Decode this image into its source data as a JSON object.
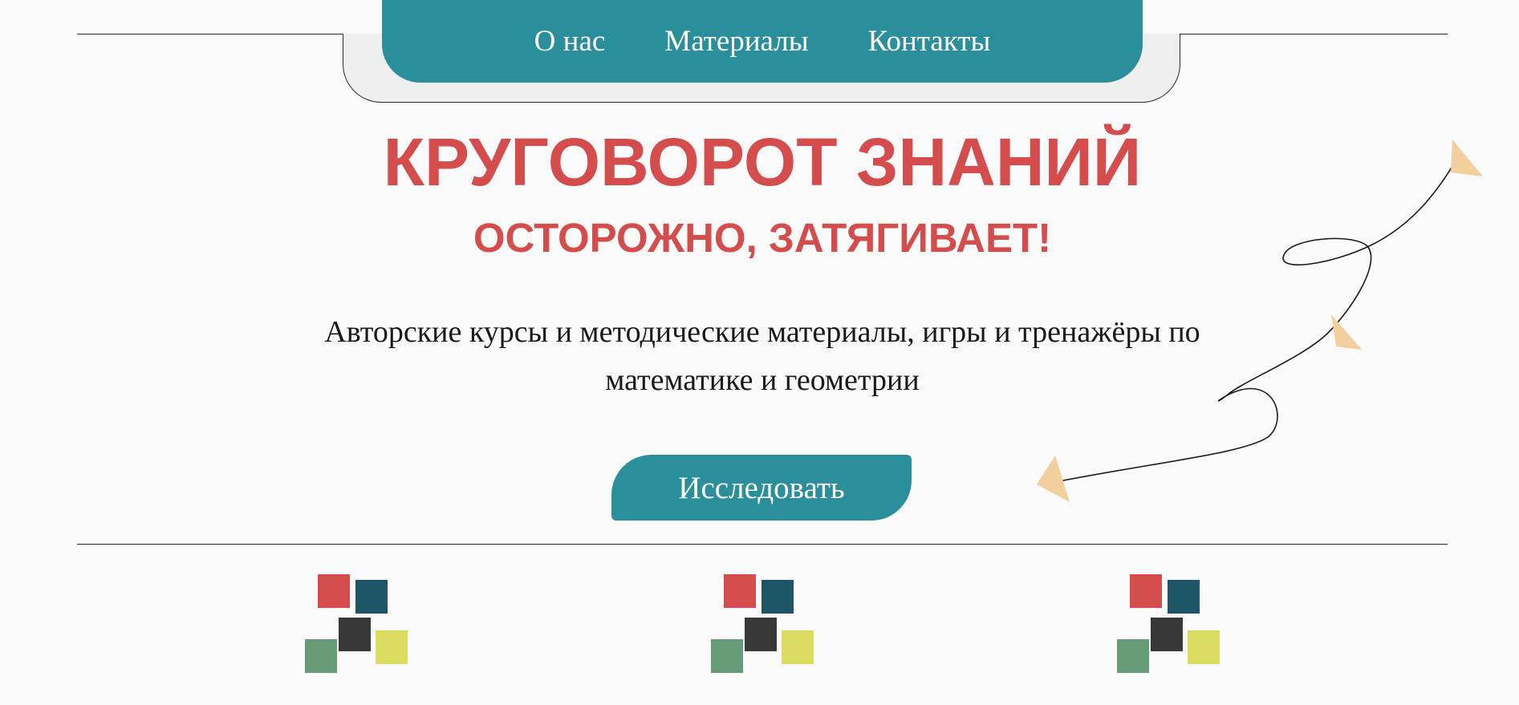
{
  "nav": {
    "items": [
      {
        "label": "О нас"
      },
      {
        "label": "Материалы"
      },
      {
        "label": "Контакты"
      }
    ]
  },
  "hero": {
    "title": "КРУГОВОРОТ ЗНАНИЙ",
    "subtitle": "ОСТОРОЖНО, ЗАТЯГИВАЕТ!",
    "description": "Авторские курсы и методические материалы, игры и тренажёры по математике и геометрии",
    "cta_label": "Исследовать"
  },
  "colors": {
    "accent_teal": "#2a8f9a",
    "title_red": "#d44c4c",
    "background": "#fafafa",
    "arrow_peach": "#f2cf9c",
    "square_red": "#d44c4c",
    "square_navy": "#1c5566",
    "square_dark": "#383838",
    "square_yellow": "#d9dc5f",
    "square_green": "#679c79"
  },
  "icons": {
    "feature_icon": "colored-squares-icon",
    "decoration": "swirl-arrow-path"
  }
}
